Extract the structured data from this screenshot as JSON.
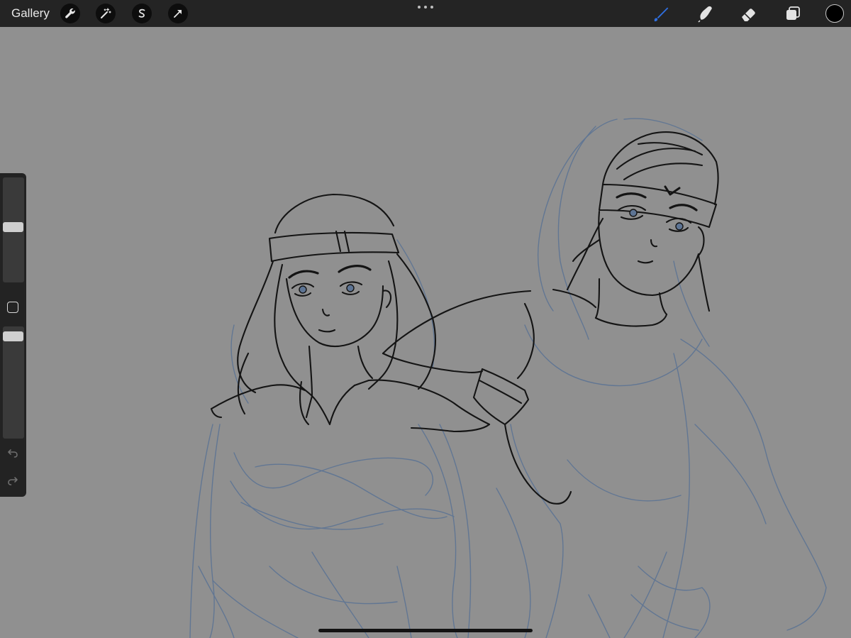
{
  "topbar": {
    "gallery_label": "Gallery",
    "left_tools": [
      "wrench-icon",
      "magic-wand-icon",
      "selection-icon",
      "transform-arrow-icon"
    ],
    "right_tools": [
      "brush-icon",
      "smudge-icon",
      "eraser-icon",
      "layers-icon"
    ],
    "active_tool": "brush-icon",
    "active_tool_color": "#2f6fe0",
    "current_color": "#000000"
  },
  "sidebar": {
    "brush_size_level": 0.53,
    "opacity_level": 0.95,
    "undo_icon": "undo-icon",
    "redo_icon": "redo-icon"
  },
  "canvas": {
    "background_color": "#909090",
    "sketch_color": "#5d7494",
    "lineart_color": "#141414"
  }
}
